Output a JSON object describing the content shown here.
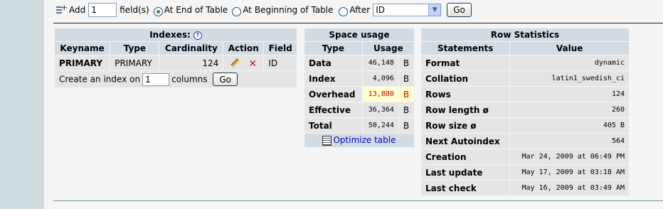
{
  "add_fields": {
    "add_label": "Add",
    "count": "1",
    "fields_label": "field(s)",
    "opt_end": "At End of Table",
    "opt_begin": "At Beginning of Table",
    "opt_after": "After",
    "after_value": "ID",
    "go": "Go"
  },
  "indexes": {
    "title": "Indexes:",
    "headers": [
      "Keyname",
      "Type",
      "Cardinality",
      "Action",
      "Field"
    ],
    "row": {
      "keyname": "PRIMARY",
      "type": "PRIMARY",
      "cardinality": "124",
      "field": "ID"
    },
    "create_prefix": "Create an index on",
    "create_count": "1",
    "create_suffix": "columns",
    "go": "Go"
  },
  "space_usage": {
    "title": "Space usage",
    "headers": [
      "Type",
      "Usage"
    ],
    "rows": [
      {
        "type": "Data",
        "value": "46,148",
        "unit": "B"
      },
      {
        "type": "Index",
        "value": "4,096",
        "unit": "B"
      },
      {
        "type": "Overhead",
        "value": "13,880",
        "unit": "B"
      },
      {
        "type": "Effective",
        "value": "36,364",
        "unit": "B"
      },
      {
        "type": "Total",
        "value": "50,244",
        "unit": "B"
      }
    ],
    "optimize": "Optimize table"
  },
  "row_stats": {
    "title": "Row Statistics",
    "headers": [
      "Statements",
      "Value"
    ],
    "rows": [
      {
        "label": "Format",
        "value": "dynamic"
      },
      {
        "label": "Collation",
        "value": "latin1_swedish_ci"
      },
      {
        "label": "Rows",
        "value": "124"
      },
      {
        "label": "Row length ø",
        "value": "260"
      },
      {
        "label": "Row size ø",
        "value": "405 B"
      },
      {
        "label": "Next Autoindex",
        "value": "564"
      },
      {
        "label": "Creation",
        "value": "Mar 24, 2009 at 06:49 PM"
      },
      {
        "label": "Last update",
        "value": "May 17, 2009 at 03:18 AM"
      },
      {
        "label": "Last check",
        "value": "May 16, 2009 at 03:49 AM"
      }
    ]
  }
}
